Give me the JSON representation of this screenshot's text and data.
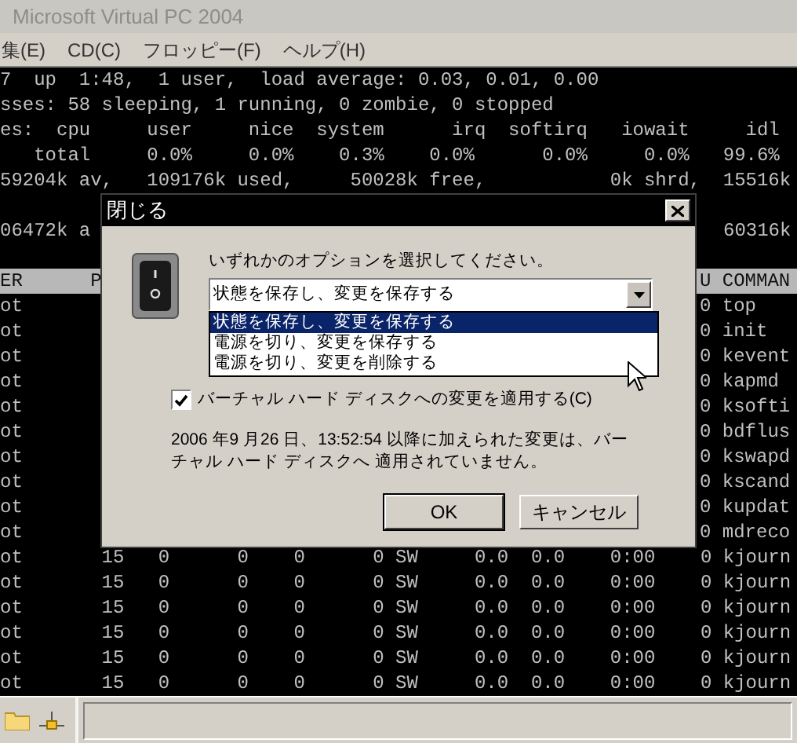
{
  "window": {
    "title": "Microsoft Virtual PC 2004"
  },
  "menu": [
    {
      "label": "集(E)"
    },
    {
      "label": "CD(C)"
    },
    {
      "label": "フロッピー(F)"
    },
    {
      "label": "ヘルプ(H)"
    }
  ],
  "terminal": {
    "summary": [
      "7  up  1:48,  1 user,  load average: 0.03, 0.01, 0.00",
      "sses: 58 sleeping, 1 running, 0 zombie, 0 stopped",
      "es:  cpu     user     nice  system      irq  softirq   iowait     idl",
      "   total     0.0%     0.0%    0.3%    0.0%      0.0%     0.0%   99.6%",
      "59204k av,   109176k used,     50028k free,           0k shrd,  15516k"
    ],
    "memory_line": {
      "left": "06472k a",
      "right": "60316k"
    },
    "header": {
      "left": "ER      P",
      "right": "U COMMAN"
    },
    "rows": [
      {
        "kind": "split",
        "left": "ot",
        "right": "0 top"
      },
      {
        "kind": "split",
        "left": "ot",
        "right": "0 init"
      },
      {
        "kind": "split",
        "left": "ot",
        "right": "0 kevent"
      },
      {
        "kind": "split",
        "left": "ot",
        "right": "0 kapmd"
      },
      {
        "kind": "split",
        "left": "ot",
        "right": "0 ksofti"
      },
      {
        "kind": "split",
        "left": "ot",
        "right": "0 bdflus"
      },
      {
        "kind": "split",
        "left": "ot",
        "right": "0 kswapd"
      },
      {
        "kind": "split",
        "left": "ot",
        "right": "0 kscand"
      },
      {
        "kind": "split",
        "left": "ot",
        "right": "0 kupdat"
      },
      {
        "kind": "split",
        "left": "ot",
        "right": "0 mdreco"
      },
      {
        "kind": "full",
        "text": "ot       15   0      0    0      0 SW     0.0  0.0    0:00    0 kjourn"
      },
      {
        "kind": "full",
        "text": "ot       15   0      0    0      0 SW     0.0  0.0    0:00    0 kjourn"
      },
      {
        "kind": "full",
        "text": "ot       15   0      0    0      0 SW     0.0  0.0    0:00    0 kjourn"
      },
      {
        "kind": "full",
        "text": "ot       15   0      0    0      0 SW     0.0  0.0    0:00    0 kjourn"
      },
      {
        "kind": "full",
        "text": "ot       15   0      0    0      0 SW     0.0  0.0    0:00    0 kjourn"
      },
      {
        "kind": "full",
        "text": "ot       15   0      0    0      0 SW     0.0  0.0    0:00    0 kjourn"
      }
    ]
  },
  "dialog": {
    "title": "閉じる",
    "prompt": "いずれかのオプションを選択してください。",
    "combo": {
      "value": "状態を保存し、変更を保存する",
      "expanded": true
    },
    "options": [
      {
        "label": "状態を保存し、変更を保存する",
        "selected": true
      },
      {
        "label": "電源を切り、変更を保存する",
        "selected": false
      },
      {
        "label": "電源を切り、変更を削除する",
        "selected": false
      }
    ],
    "checkbox": {
      "label": "バーチャル ハード ディスクへの変更を適用する(C)",
      "checked": true
    },
    "note": "2006 年9 月26 日、13:52:54 以降に加えられた変更は、バーチャル ハード ディスクへ 適用されていません。",
    "buttons": [
      {
        "label": "OK",
        "default": true
      },
      {
        "label": "キャンセル",
        "default": false
      }
    ]
  }
}
